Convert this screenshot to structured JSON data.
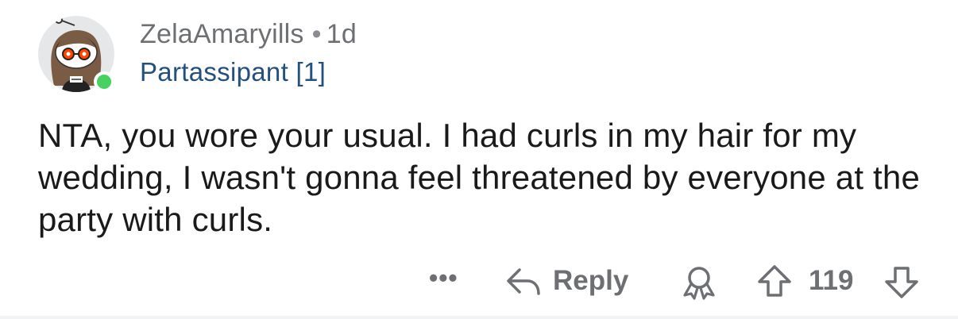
{
  "comment": {
    "author": "ZelaAmaryills",
    "separator": "•",
    "age": "1d",
    "flair": "Partassipant [1]",
    "body": "NTA, you wore your usual. I had curls in my hair for my wedding, I wasn't gonna feel threatened by everyone at the party with curls.",
    "online_status_color": "#46d160"
  },
  "actions": {
    "more_label": "•••",
    "more_icon": "ellipsis-icon",
    "reply_label": "Reply",
    "reply_icon": "reply-arrow-icon",
    "award_icon": "award-icon",
    "upvote_icon": "upvote-arrow-icon",
    "score": "119",
    "downvote_icon": "downvote-arrow-icon"
  },
  "colors": {
    "text_primary": "#1a1a1b",
    "text_meta": "#6d6f73",
    "flair": "#24507e"
  }
}
